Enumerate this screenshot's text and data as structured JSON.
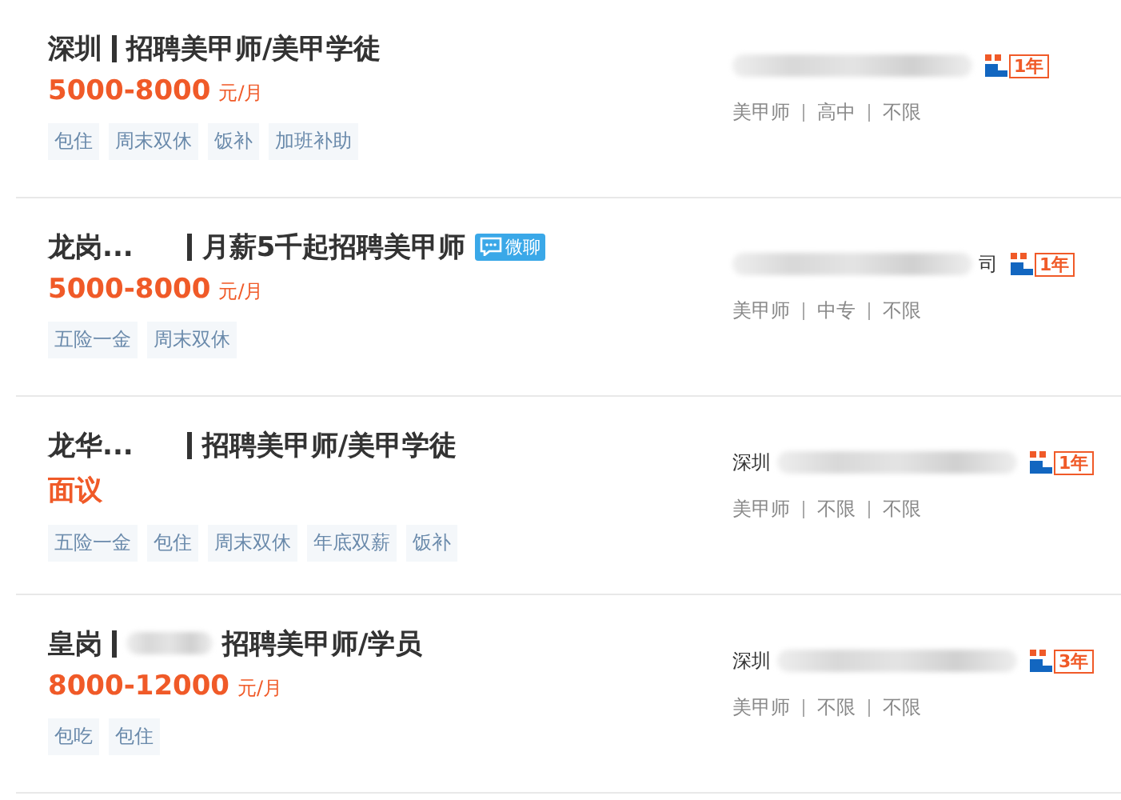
{
  "jobs": [
    {
      "kind": "plain",
      "location": "深圳",
      "title": "招聘美甲师/美甲学徒",
      "salary": "5000-8000",
      "unit": "元/月",
      "tags": [
        "包住",
        "周末双休",
        "饭补",
        "加班补助"
      ],
      "years": "1年",
      "details": [
        "美甲师",
        "高中",
        "不限"
      ]
    },
    {
      "kind": "masked-location",
      "location": "龙岗...",
      "title": "月薪5千起招聘美甲师",
      "chat_badge": "微聊",
      "salary": "5000-8000",
      "unit": "元/月",
      "tags": [
        "五险一金",
        "周末双休"
      ],
      "company_suffix": "司",
      "years": "1年",
      "details": [
        "美甲师",
        "中专",
        "不限"
      ]
    },
    {
      "kind": "masked-location",
      "location": "龙华...",
      "title": "招聘美甲师/美甲学徒",
      "salary": "面议",
      "tags": [
        "五险一金",
        "包住",
        "周末双休",
        "年底双薪",
        "饭补"
      ],
      "company_prefix": "深圳",
      "years": "1年",
      "details": [
        "美甲师",
        "不限",
        "不限"
      ]
    },
    {
      "kind": "masked-title",
      "location": "皇岗",
      "title": "招聘美甲师/学员",
      "salary": "8000-12000",
      "unit": "元/月",
      "tags": [
        "包吃",
        "包住"
      ],
      "company_prefix": "深圳",
      "years": "3年",
      "details": [
        "美甲师",
        "不限",
        "不限"
      ]
    }
  ]
}
